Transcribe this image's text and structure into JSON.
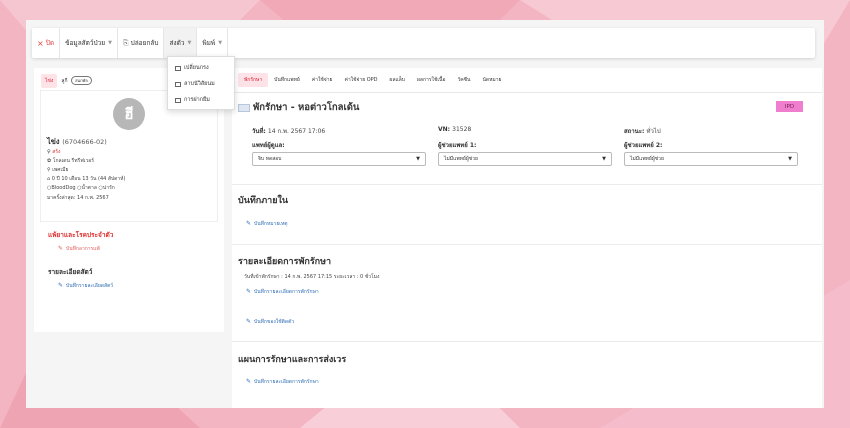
{
  "colors": {
    "background": "#f3b5c2",
    "accent": "#d22b3b",
    "link": "#2f6fb5",
    "badge": "#f07ecf"
  },
  "toolbar": {
    "close_label": "ปิด",
    "items": [
      {
        "label": "ข้อมูลสัตว์ป่วย"
      },
      {
        "label": "ปล่อยกลับ"
      },
      {
        "label": "ส่งตัว"
      },
      {
        "label": "พิมพ์"
      }
    ]
  },
  "dropdown": {
    "items": [
      {
        "label": "เปลี่ยนกรง",
        "icon": "cage-icon"
      },
      {
        "label": "ลาบนัวิสัยนม",
        "icon": "list-icon"
      },
      {
        "label": "การฝากยืม",
        "icon": "deposit-icon"
      }
    ]
  },
  "left_tabs": [
    {
      "label": "ไข่ง"
    },
    {
      "label": "ลูกี",
      "pill": "สนกพัล"
    }
  ],
  "patient": {
    "avatar_letter": "ฮี",
    "name": "ไข่ง",
    "hn": "(6704666-02)",
    "gender_line": "สร้ง",
    "owner_line": "โกลเดน รีทรีฟเวอร์",
    "location_line": "เพศเมีย",
    "age_line": "0 ปี 10 เดือน 13 วัน (44 สัปดาห์)",
    "tags": [
      "BloodDog",
      "น้ำตาล",
      "น่ารัก"
    ],
    "visit_line": "มาครั้งล่าสุด: 14 ก.พ. 2567"
  },
  "left_sections": {
    "allergy_title": "แพ้ยาและโรคประจำตัว",
    "allergy_link": "บันทึกอาการแพ้",
    "details_title": "รายละเอียดสัตว์",
    "details_link": "บันทึกรายละเอียดสัตว์"
  },
  "main_tabs": [
    {
      "label": "พักรักษา"
    },
    {
      "label": "บันทึกแพทย์"
    },
    {
      "label": "ค่าใช้จ่าย"
    },
    {
      "label": "ค่าใช้จ่าย OPD"
    },
    {
      "label": "ผลแล็บ"
    },
    {
      "label": "ผลการใช้เนื้อ"
    },
    {
      "label": "วัคซีน"
    },
    {
      "label": "นัดหมาย"
    }
  ],
  "admission": {
    "title": "พักรักษา - หอต่าวโกลเด้น",
    "badge": "IPD",
    "date_label": "วันที่:",
    "date_value": "14 ก.พ. 2567 17:06",
    "vn_label": "VN:",
    "vn_value": "31528",
    "status_label": "สถานะ:",
    "status_value": "ทั่วไป",
    "doctor_label": "แพทย์ผู้ดูแล:",
    "doctor_value": "จิบ ทดสอบ",
    "asst1_label": "ผู้ช่วยแพทย์ 1:",
    "asst1_value": "ไม่มีแพทย์ผู้ช่วย",
    "asst2_label": "ผู้ช่วยแพทย์ 2:",
    "asst2_value": "ไม่มีแพทย์ผู้ช่วย"
  },
  "sections": {
    "internal_title": "บันทึกภายใน",
    "internal_link": "บันทึกหมายเหตุ",
    "detail_title": "รายละเอียดการพักรักษา",
    "detail_text": "วันที่เข้าพักรักษา : 14 ก.พ. 2567 17:15 ระยะเวลา : 0 ชั่วโมง",
    "detail_link": "บันทึกรายละเอียดการพักรักษา",
    "daily_link": "บันทึกของใช้ติดตัว",
    "plan_title": "แผนการรักษาและการส่งเวร",
    "plan_link": "บันทึกรายละเอียดการพักรักษา"
  }
}
